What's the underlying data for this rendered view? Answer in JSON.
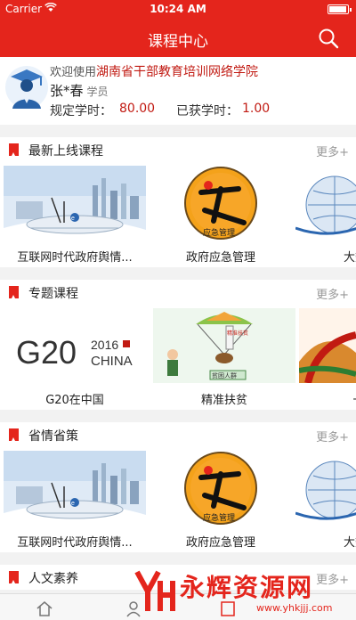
{
  "status_bar": {
    "carrier": "Carrier",
    "time": "10:24 AM"
  },
  "nav": {
    "title": "课程中心",
    "search_icon": "search-icon"
  },
  "profile": {
    "welcome_prefix": "欢迎使用",
    "org": "湖南省干部教育培训网络学院",
    "name": "张*春",
    "role": "学员",
    "required_label": "规定学时：",
    "required_value": "80.00",
    "earned_label": "已获学时：",
    "earned_value": "1.00"
  },
  "sections": [
    {
      "title": "最新上线课程",
      "more": "更多+",
      "courses": [
        {
          "label": "互联网时代政府舆情...",
          "thumb": "internet-city"
        },
        {
          "label": "政府应急管理",
          "thumb": "emergency-logo"
        },
        {
          "label": "大数据时",
          "thumb": "bigdata-globe"
        }
      ]
    },
    {
      "title": "专题课程",
      "more": "更多+",
      "courses": [
        {
          "label": "G20在中国",
          "thumb": "g20-china",
          "thumb_text": "2016",
          "thumb_g20": "G20",
          "thumb_china": "CHINA"
        },
        {
          "label": "精准扶贫",
          "thumb": "parachute-poverty",
          "thumb_text": "精准扶贫",
          "thumb_text2": "贫困人群"
        },
        {
          "label": "一带一",
          "thumb": "belt-road"
        }
      ]
    },
    {
      "title": "省情省策",
      "more": "更多+",
      "courses": [
        {
          "label": "互联网时代政府舆情...",
          "thumb": "internet-city"
        },
        {
          "label": "政府应急管理",
          "thumb": "emergency-logo"
        },
        {
          "label": "大数据时",
          "thumb": "bigdata-globe"
        }
      ]
    },
    {
      "title": "人文素养",
      "more": "更多+",
      "courses": []
    }
  ],
  "emergency_logo_text": "应急管理",
  "watermark": {
    "text": "永辉资源网",
    "url": "www.yhkjjj.com"
  },
  "colors": {
    "brand_red": "#e4251c",
    "value_red": "#c11a12"
  }
}
